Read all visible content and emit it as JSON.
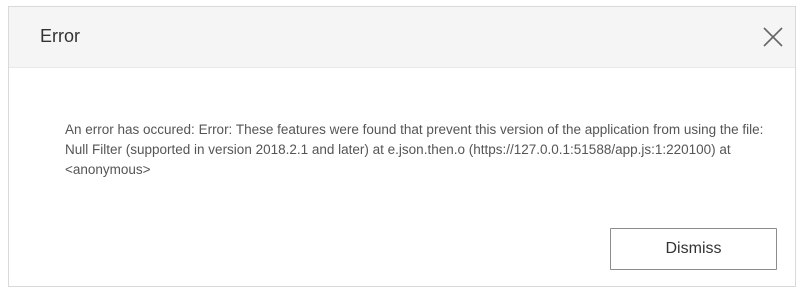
{
  "dialog": {
    "title": "Error",
    "close_icon": "close-icon",
    "message": "An error has occured: Error: These features were found that prevent this version of the application from using the file: Null Filter (supported in version 2018.2.1 and later) at e.json.then.o (https://127.0.0.1:51588/app.js:1:220100) at <anonymous>",
    "dismiss_label": "Dismiss"
  },
  "colors": {
    "header_bg": "#f5f5f5",
    "border": "#d9d9d9",
    "text": "#555555",
    "button_border": "#8c8c8c"
  }
}
